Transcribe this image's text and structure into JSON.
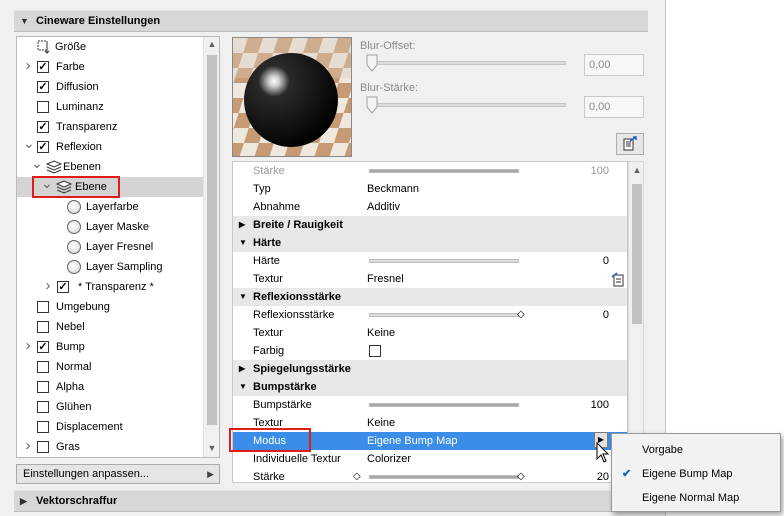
{
  "header": {
    "title": "Cineware Einstellungen"
  },
  "tree": {
    "items": [
      {
        "label": "Größe",
        "checkbox": "none",
        "chevron": "",
        "icon": "resize-icon"
      },
      {
        "label": "Farbe",
        "checkbox": "checked",
        "chevron": "right"
      },
      {
        "label": "Diffusion",
        "checkbox": "checked",
        "chevron": ""
      },
      {
        "label": "Luminanz",
        "checkbox": "unchecked",
        "chevron": ""
      },
      {
        "label": "Transparenz",
        "checkbox": "checked",
        "chevron": ""
      },
      {
        "label": "Reflexion",
        "checkbox": "checked",
        "chevron": "down"
      },
      {
        "label": "Ebenen",
        "chevron": "down",
        "icon": "layers-icon"
      },
      {
        "label": "Ebene",
        "chevron": "down",
        "icon": "layers-icon",
        "selected": true
      },
      {
        "label": "Layerfarbe",
        "radio": true
      },
      {
        "label": "Layer Maske",
        "radio": true
      },
      {
        "label": "Layer Fresnel",
        "radio": true
      },
      {
        "label": "Layer Sampling",
        "radio": true
      },
      {
        "label": "* Transparenz *",
        "checkbox": "checked",
        "chevron": "right"
      },
      {
        "label": "Umgebung",
        "checkbox": "unchecked"
      },
      {
        "label": "Nebel",
        "checkbox": "unchecked"
      },
      {
        "label": "Bump",
        "checkbox": "checked",
        "chevron": "right"
      },
      {
        "label": "Normal",
        "checkbox": "unchecked"
      },
      {
        "label": "Alpha",
        "checkbox": "unchecked"
      },
      {
        "label": "Glühen",
        "checkbox": "unchecked"
      },
      {
        "label": "Displacement",
        "checkbox": "unchecked"
      },
      {
        "label": "Gras",
        "checkbox": "unchecked",
        "chevron": "right"
      }
    ]
  },
  "settings_button": {
    "label": "Einstellungen anpassen..."
  },
  "blur": {
    "offset_label": "Blur-Offset:",
    "offset_value": "0,00",
    "strength_label": "Blur-Stärke:",
    "strength_value": "0,00"
  },
  "props": {
    "rows": [
      {
        "kind": "prop",
        "name": "Stärke",
        "slider": 1.0,
        "num": "100",
        "disabled": true
      },
      {
        "kind": "prop",
        "name": "Typ",
        "value": "Beckmann"
      },
      {
        "kind": "prop",
        "name": "Abnahme",
        "value": "Additiv"
      },
      {
        "kind": "group",
        "name": "Breite / Rauigkeit",
        "open": false
      },
      {
        "kind": "group",
        "name": "Härte",
        "open": true
      },
      {
        "kind": "prop",
        "name": "Härte",
        "slider": 0.0,
        "num": "0"
      },
      {
        "kind": "prop",
        "name": "Textur",
        "value": "Fresnel",
        "texicon": true
      },
      {
        "kind": "group",
        "name": "Reflexionsstärke",
        "open": true
      },
      {
        "kind": "prop",
        "name": "Reflexionsstärke",
        "slider": 0.0,
        "num": "0",
        "arrow": true
      },
      {
        "kind": "prop",
        "name": "Textur",
        "value": "Keine"
      },
      {
        "kind": "prop",
        "name": "Farbig",
        "checkbox": true
      },
      {
        "kind": "group",
        "name": "Spiegelungsstärke",
        "open": false
      },
      {
        "kind": "group",
        "name": "Bumpstärke",
        "open": true
      },
      {
        "kind": "prop",
        "name": "Bumpstärke",
        "slider": 1.0,
        "num": "100"
      },
      {
        "kind": "prop",
        "name": "Textur",
        "value": "Keine"
      },
      {
        "kind": "prop",
        "name": "Modus",
        "value": "Eigene Bump Map",
        "highlight": true
      },
      {
        "kind": "prop",
        "name": "Individuelle Textur",
        "value": "Colorizer"
      },
      {
        "kind": "prop",
        "name": "Stärke",
        "slider": 1.0,
        "num": "20",
        "arrows": true
      }
    ]
  },
  "footer": {
    "title": "Vektorschraffur"
  },
  "popup": {
    "items": [
      {
        "label": "Vorgabe",
        "checked": false
      },
      {
        "label": "Eigene Bump Map",
        "checked": true
      },
      {
        "label": "Eigene Normal Map",
        "checked": false
      }
    ]
  },
  "colors": {
    "highlight": "#3b8ee8",
    "annotation": "#e21b1b",
    "check": "#1a60c6"
  }
}
